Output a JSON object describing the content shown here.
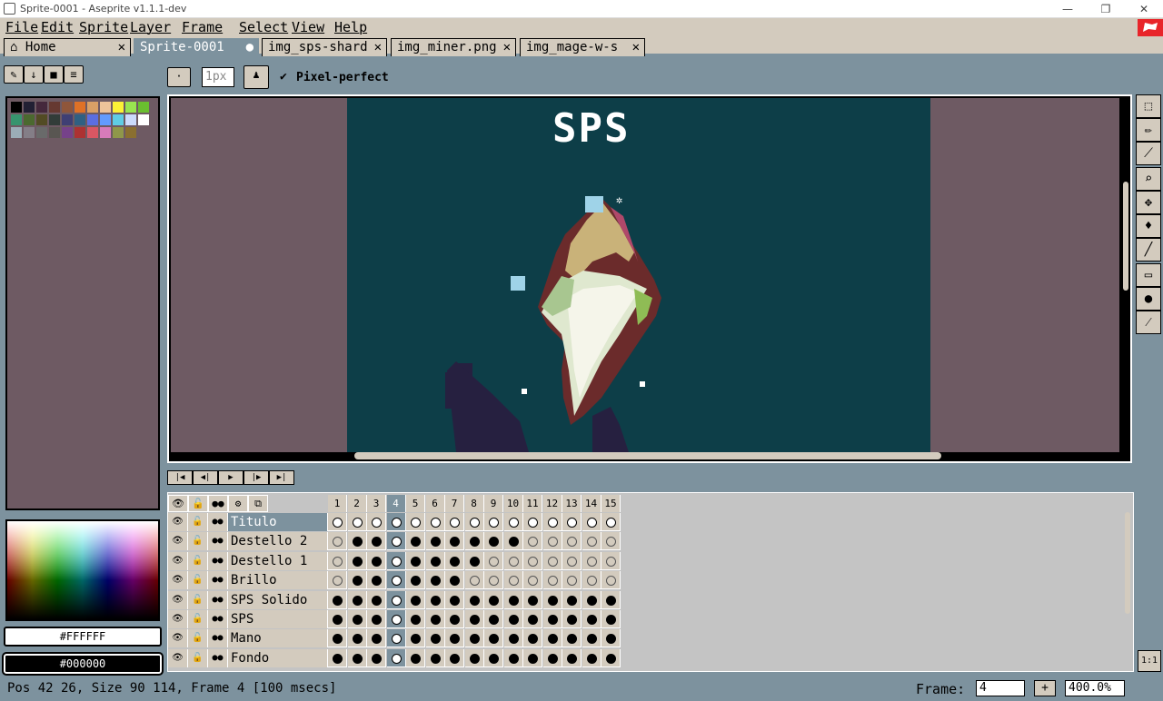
{
  "window": {
    "title": "Sprite-0001 - Aseprite v1.1.1-dev"
  },
  "menu": [
    "File",
    "Edit",
    "Sprite",
    "Layer",
    "Frame",
    "Select",
    "View",
    "Help"
  ],
  "tabs": [
    {
      "label": "Home",
      "active": false
    },
    {
      "label": "Sprite-0001",
      "active": true
    },
    {
      "label": "img_sps-shard",
      "active": false
    },
    {
      "label": "img_miner.png",
      "active": false
    },
    {
      "label": "img_mage-w-s",
      "active": false
    }
  ],
  "context": {
    "brush_size": "1px",
    "pixel_perfect": "Pixel-perfect"
  },
  "canvas_title": "SPS",
  "colors": {
    "foreground": "#FFFFFF",
    "background": "#000000"
  },
  "palette": [
    "#000000",
    "#222034",
    "#45283c",
    "#663931",
    "#8f563b",
    "#df7126",
    "#d9a066",
    "#eec39a",
    "#fbf236",
    "#99e550",
    "#6abe30",
    "#37946e",
    "#4b692f",
    "#524b24",
    "#323c39",
    "#3f3f74",
    "#306082",
    "#5b6ee1",
    "#639bff",
    "#5fcde4",
    "#cbdbfc",
    "#ffffff",
    "#9badb7",
    "#847e87",
    "#696a6a",
    "#595652",
    "#76428a",
    "#ac3232",
    "#d95763",
    "#d77bba",
    "#8f974a",
    "#8a6f30"
  ],
  "timeline": {
    "frames": [
      "1",
      "2",
      "3",
      "4",
      "5",
      "6",
      "7",
      "8",
      "9",
      "10",
      "11",
      "12",
      "13",
      "14",
      "15"
    ],
    "current_frame_index": 3,
    "layers": [
      {
        "name": "Titulo",
        "active": true,
        "cels": "wwwwwwwwwwwwwww"
      },
      {
        "name": "Destello 2",
        "active": false,
        "cels": "efffffffffeeeee"
      },
      {
        "name": "Destello 1",
        "active": false,
        "cels": "efffffffeeeeeee"
      },
      {
        "name": "Brillo",
        "active": false,
        "cels": "effffffeeeeeeee"
      },
      {
        "name": "SPS Solido",
        "active": false,
        "cels": "fffffffffffffff"
      },
      {
        "name": "SPS",
        "active": false,
        "cels": "fffffffffffffff"
      },
      {
        "name": "Mano",
        "active": false,
        "cels": "fffffffffffffff"
      },
      {
        "name": "Fondo",
        "active": false,
        "cels": "fffffffffffffff"
      }
    ]
  },
  "status": {
    "text": "Pos 42 26, Size 90 114, Frame 4 [100 msecs]",
    "frame_label": "Frame:",
    "frame_value": "4",
    "plus": "+",
    "zoom": "400.0%",
    "one_to_one": "1:1"
  }
}
